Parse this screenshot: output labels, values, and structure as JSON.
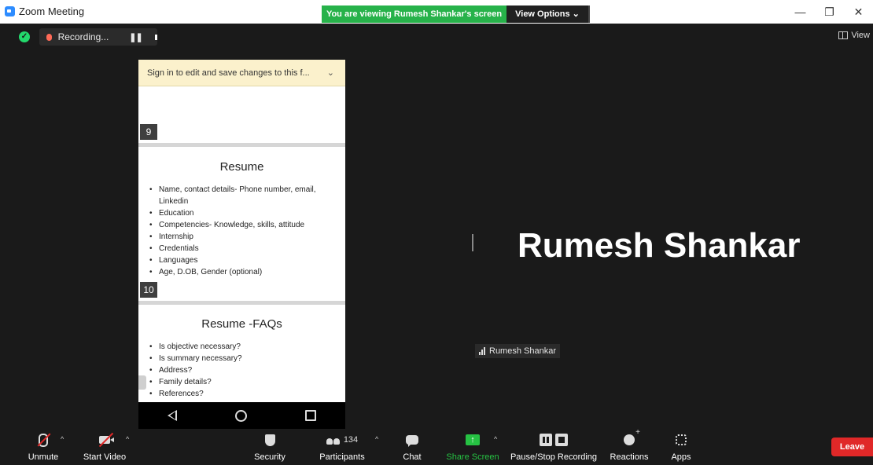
{
  "window": {
    "title": "Zoom Meeting"
  },
  "banner": {
    "viewing": "You are viewing Rumesh Shankar's screen",
    "view_options": "View Options ⌄"
  },
  "window_controls": {
    "minimize": "—",
    "restore": "❐",
    "close": "✕"
  },
  "recording": {
    "label": "Recording...",
    "pause": "❚❚"
  },
  "view_label": "View",
  "share": {
    "signin_bar": "Sign in to edit and save changes to this f...",
    "signin_chevron": "⌄",
    "slides": [
      {
        "page": "9"
      },
      {
        "title": "Resume",
        "bullets": [
          "Name, contact details- Phone number, email, Linkedin",
          "Education",
          "Competencies- Knowledge, skills, attitude",
          "Internship",
          "Credentials",
          "Languages",
          "Age, D.OB, Gender (optional)"
        ],
        "page": "10"
      },
      {
        "title": "Resume -FAQs",
        "bullets": [
          "Is objective necessary?",
          "Is summary necessary?",
          "Address?",
          "Family details?",
          "References?"
        ]
      }
    ]
  },
  "speaker": {
    "big_name": "Rumesh Shankar",
    "tag": "Rumesh Shankar"
  },
  "toolbar": {
    "unmute": "Unmute",
    "start_video": "Start Video",
    "security": "Security",
    "participants_count": "134",
    "participants": "Participants",
    "chat": "Chat",
    "share_screen": "Share Screen",
    "share_arrow": "↑",
    "pause_stop_recording": "Pause/Stop Recording",
    "reactions": "Reactions",
    "apps": "Apps",
    "leave": "Leave",
    "caret": "^"
  },
  "colors": {
    "banner_green": "#27b24a",
    "share_green": "#26c243",
    "leave_red": "#e02828",
    "record_red": "#ff6a57",
    "shield_green": "#23d96c"
  },
  "icons": [
    "zoom-logo-icon",
    "shield-check-icon",
    "cloud-record-icon",
    "pause-icon",
    "stop-icon",
    "gallery-view-icon",
    "chevron-down-icon",
    "android-back-icon",
    "android-home-icon",
    "android-recents-icon",
    "signal-icon",
    "mic-muted-icon",
    "video-off-icon",
    "security-shield-icon",
    "participants-icon",
    "chat-icon",
    "share-screen-icon",
    "pause-recording-icon",
    "stop-recording-icon",
    "reactions-icon",
    "apps-icon"
  ]
}
